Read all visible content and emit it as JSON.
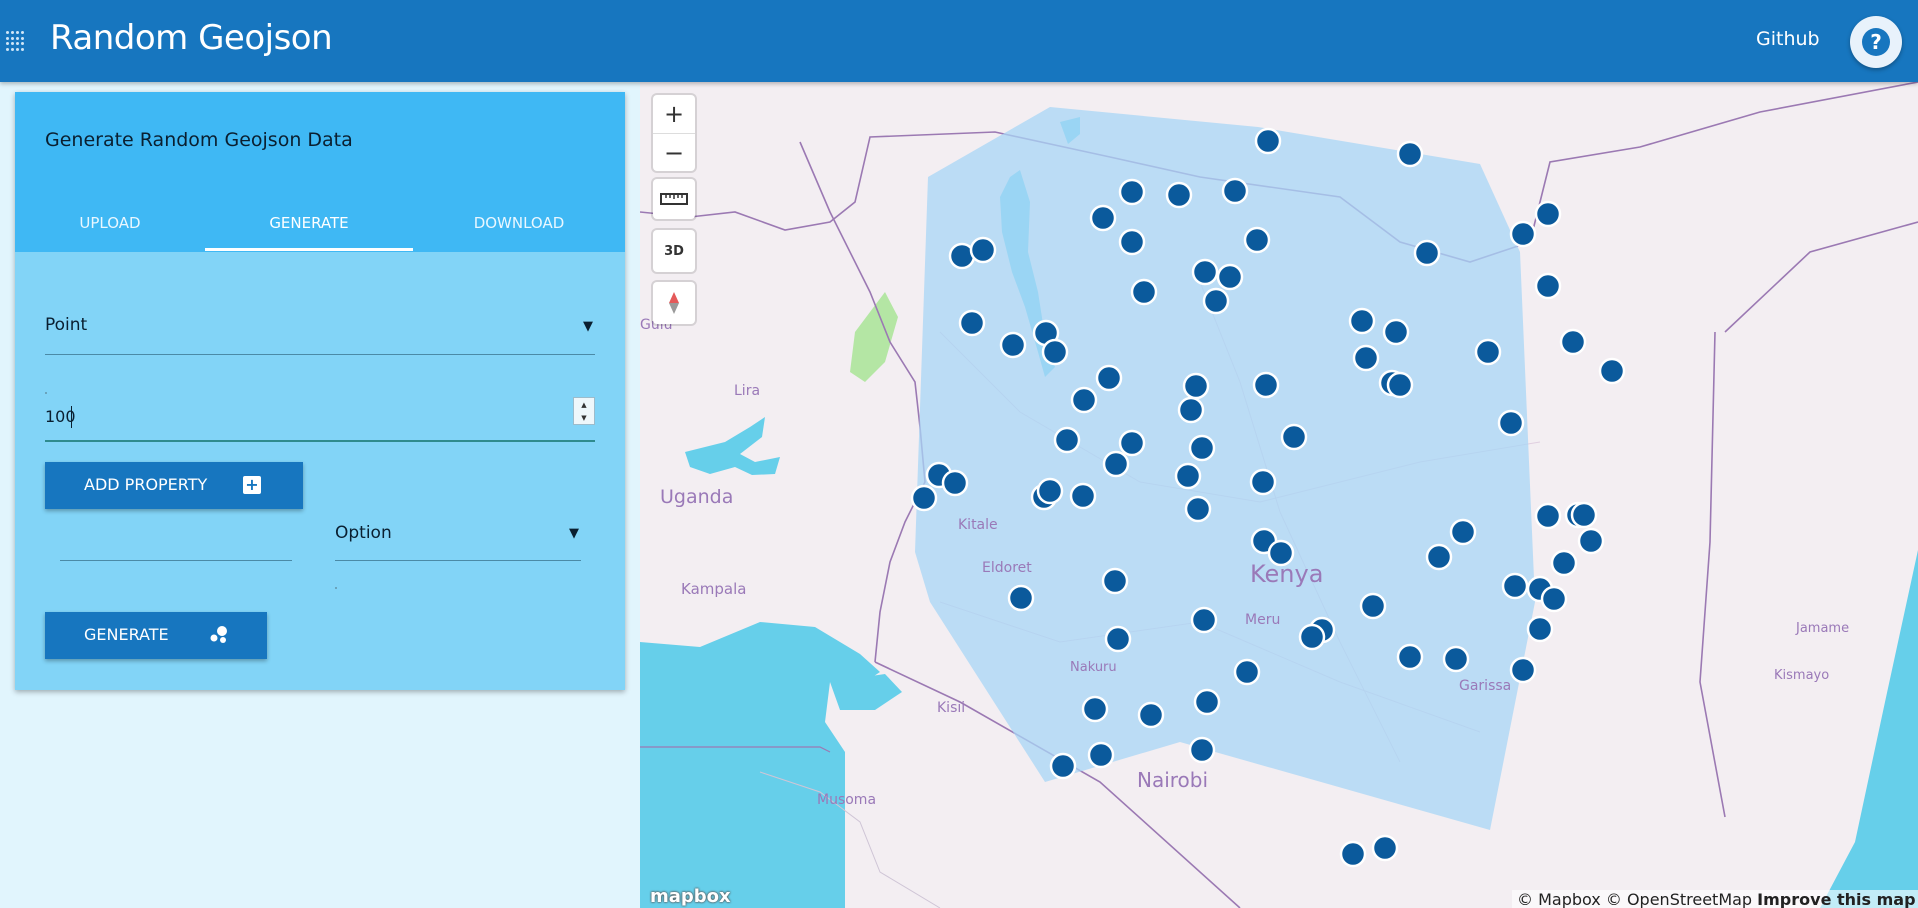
{
  "header": {
    "title": "Random Geojson",
    "github_label": "Github",
    "help_label": "?"
  },
  "panel": {
    "title": "Generate Random Geojson Data",
    "tabs": [
      {
        "label": "UPLOAD",
        "active": false
      },
      {
        "label": "GENERATE",
        "active": true
      },
      {
        "label": "DOWNLOAD",
        "active": false
      }
    ],
    "geometry_type": "Point",
    "count": "100",
    "add_property_label": "ADD PROPERTY",
    "property_type": "Option",
    "generate_label": "GENERATE"
  },
  "map": {
    "labels": {
      "uganda": "Uganda",
      "kenya": "Kenya",
      "nairobi": "Nairobi",
      "kampala": "Kampala",
      "lira": "Lira",
      "gulu": "Gulu",
      "kitale": "Kitale",
      "eldoret": "Eldoret",
      "meru": "Meru",
      "nakuru": "Nakuru",
      "kisii": "Kisii",
      "musoma": "Musoma",
      "garissa": "Garissa",
      "jamame": "Jamame",
      "kismayo": "Kismayo"
    },
    "ruler_icon": "ruler-icon",
    "three_d_label": "3D",
    "compass_icon": "compass-icon",
    "logo": "mapbox",
    "attribution_mapbox": "© Mapbox",
    "attribution_osm": "© OpenStreetMap",
    "attribution_improve": "Improve this map",
    "point_color": "#0b5a9c",
    "polygon_fill": "#a8d6f6"
  }
}
